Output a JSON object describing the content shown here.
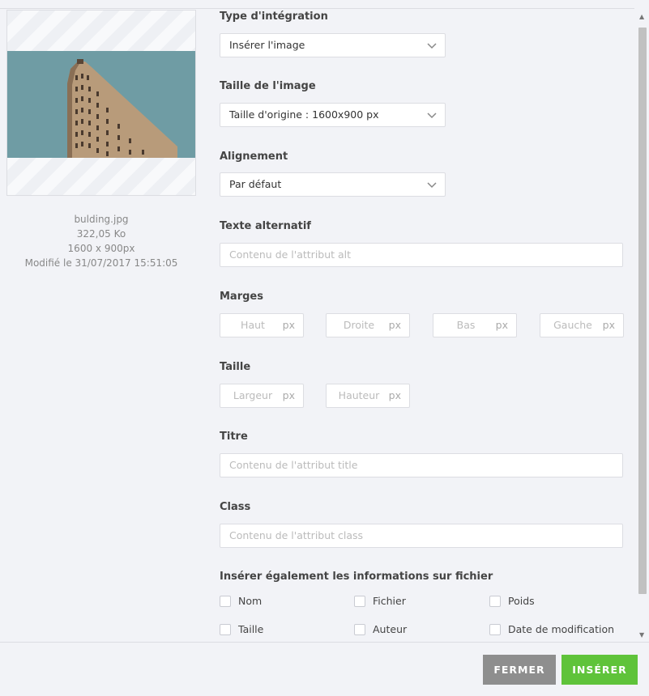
{
  "file": {
    "name": "bulding.jpg",
    "size": "322,05 Ko",
    "dimensions": "1600 x 900px",
    "modified": "Modifié le 31/07/2017 15:51:05"
  },
  "form": {
    "integration": {
      "label": "Type d'intégration",
      "value": "Insérer l'image"
    },
    "image_size": {
      "label": "Taille de l'image",
      "value": "Taille d'origine : 1600x900 px"
    },
    "alignment": {
      "label": "Alignement",
      "value": "Par défaut"
    },
    "alt": {
      "label": "Texte alternatif",
      "placeholder": "Contenu de l'attribut alt"
    },
    "margins": {
      "label": "Marges",
      "unit": "px",
      "fields": [
        "Haut",
        "Droite",
        "Bas",
        "Gauche"
      ]
    },
    "size": {
      "label": "Taille",
      "unit": "px",
      "fields": [
        "Largeur",
        "Hauteur"
      ]
    },
    "title": {
      "label": "Titre",
      "placeholder": "Contenu de l'attribut title"
    },
    "class": {
      "label": "Class",
      "placeholder": "Contenu de l'attribut class"
    },
    "file_info": {
      "label": "Insérer également les informations sur fichier",
      "options": [
        "Nom",
        "Fichier",
        "Poids",
        "Taille",
        "Auteur",
        "Date de modification"
      ]
    }
  },
  "footer": {
    "close_label": "FERMER",
    "insert_label": "INSÉRER"
  },
  "colors": {
    "insert_button": "#5fc33a",
    "close_button": "#8e8e8e"
  }
}
